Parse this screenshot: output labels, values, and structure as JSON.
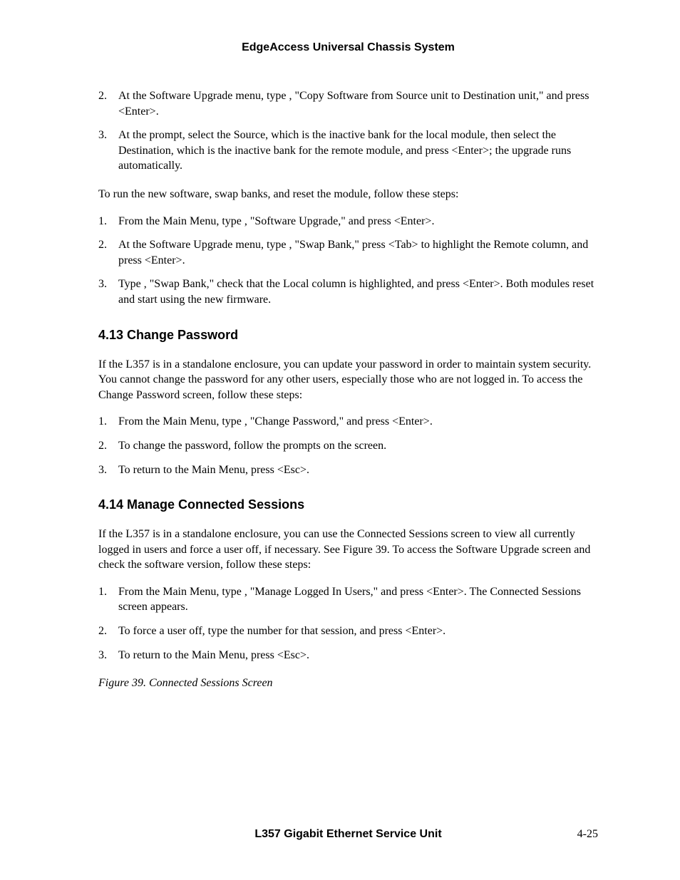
{
  "header": "EdgeAccess Universal Chassis System",
  "list1": {
    "items": [
      {
        "num": "2.",
        "text": "At the Software Upgrade menu, type   , \"Copy Software from Source unit to Destination unit,\" and press <Enter>."
      },
      {
        "num": "3.",
        "text": "At the prompt, select the Source, which is the inactive bank for the local module, then select the Destination, which is the inactive bank for the remote module, and press <Enter>; the upgrade runs automatically."
      }
    ]
  },
  "paragraph1": "To run the new software, swap banks, and reset the module, follow these steps:",
  "list2": {
    "items": [
      {
        "num": "1.",
        "text": "From the Main Menu, type   , \"Software Upgrade,\" and press <Enter>."
      },
      {
        "num": "2.",
        "text": "At the Software Upgrade menu, type   , \"Swap Bank,\" press <Tab> to highlight the Remote column, and press <Enter>."
      },
      {
        "num": "3.",
        "text": "Type   , \"Swap Bank,\" check that the Local column is highlighted, and press <Enter>.  Both modules reset and start using the new firmware."
      }
    ]
  },
  "section413": {
    "heading": "4.13   Change Password",
    "paragraph": "If the L357 is in a standalone enclosure, you can update your password  in order to maintain system security.  You cannot change the password for any other users, especially those who are not logged in.  To access the Change Password screen, follow these steps:",
    "items": [
      {
        "num": "1.",
        "text": "From the Main Menu, type   , \"Change Password,\" and press <Enter>."
      },
      {
        "num": "2.",
        "text": "To change the password, follow the prompts on the screen."
      },
      {
        "num": "3.",
        "text": "To return to the Main Menu, press <Esc>."
      }
    ]
  },
  "section414": {
    "heading": "4.14   Manage Connected Sessions",
    "paragraph": "If the L357 is in a standalone enclosure, you can use the Connected Sessions screen to view all currently logged in users and force a user off, if necessary.  See Figure 39.  To access the Software Upgrade screen and check the software version, follow these steps:",
    "items": [
      {
        "num": "1.",
        "text": "From the Main Menu, type    , \"Manage Logged In Users,\" and press <Enter>.  The Connected Sessions screen appears."
      },
      {
        "num": "2.",
        "text": "To force a user off, type the number for that session, and press <Enter>."
      },
      {
        "num": "3.",
        "text": "To return to the Main Menu, press <Esc>."
      }
    ]
  },
  "figure_caption": "Figure 39.  Connected Sessions Screen",
  "footer": {
    "title": "L357 Gigabit Ethernet Service Unit",
    "page": "4-25"
  }
}
